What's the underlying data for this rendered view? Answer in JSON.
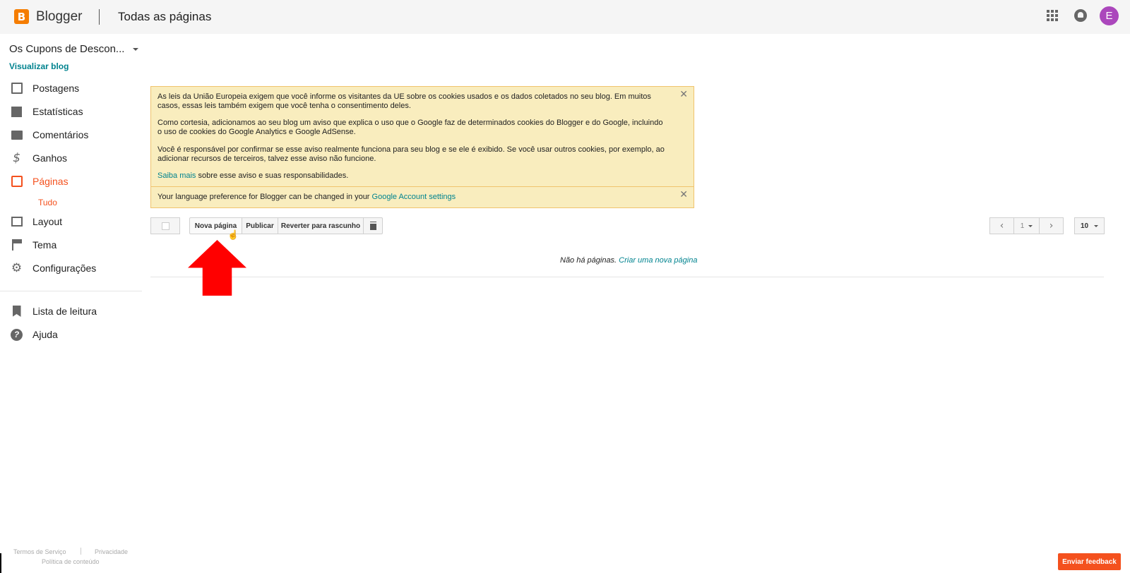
{
  "header": {
    "logo_letter": "B",
    "brand": "Blogger",
    "page_title": "Todas as páginas",
    "avatar_letter": "E"
  },
  "sidebar": {
    "blog_name": "Os Cupons de Descon...",
    "view_blog": "Visualizar blog",
    "items": [
      {
        "label": "Postagens",
        "icon": "posts-icon"
      },
      {
        "label": "Estatísticas",
        "icon": "stats-icon"
      },
      {
        "label": "Comentários",
        "icon": "comments-icon"
      },
      {
        "label": "Ganhos",
        "icon": "dollar-icon"
      },
      {
        "label": "Páginas",
        "icon": "pages-icon",
        "active": true
      },
      {
        "label": "Layout",
        "icon": "layout-icon"
      },
      {
        "label": "Tema",
        "icon": "theme-icon"
      },
      {
        "label": "Configurações",
        "icon": "gear-icon"
      },
      {
        "label": "Lista de leitura",
        "icon": "bookmark-icon"
      },
      {
        "label": "Ajuda",
        "icon": "help-icon"
      }
    ],
    "sub_item": "Tudo"
  },
  "notice": {
    "p1": "As leis da União Europeia exigem que você informe os visitantes da UE sobre os cookies usados e os dados coletados no seu blog. Em muitos casos, essas leis também exigem que você tenha o consentimento deles.",
    "p2": "Como cortesia, adicionamos ao seu blog um aviso que explica o uso que o Google faz de determinados cookies do Blogger e do Google, incluindo o uso de cookies do Google Analytics e Google AdSense.",
    "p3": "Você é responsável por confirmar se esse aviso realmente funciona para seu blog e se ele é exibido. Se você usar outros cookies, por exemplo, ao adicionar recursos de terceiros, talvez esse aviso não funcione.",
    "learn_more_link": "Saiba mais",
    "learn_more_rest": " sobre esse aviso e suas responsabilidades.",
    "lang_text": "Your language preference for Blogger can be changed in your ",
    "lang_link": "Google Account settings",
    "close_glyph": "✕"
  },
  "toolbar": {
    "new_page": "Nova página",
    "publish": "Publicar",
    "revert": "Reverter para rascunho",
    "page_number": "1",
    "per_page": "10"
  },
  "list": {
    "empty_text": "Não há páginas. ",
    "create_link": "Criar uma nova página"
  },
  "footer": {
    "terms": "Termos de Serviço",
    "privacy": "Privacidade",
    "content_policy": "Política de conteúdo",
    "feedback": "Enviar feedback"
  },
  "colors": {
    "accent": "#f4511e",
    "link": "#00838f",
    "notice_bg": "#f9edbe",
    "annotation_arrow": "#ff0000"
  }
}
